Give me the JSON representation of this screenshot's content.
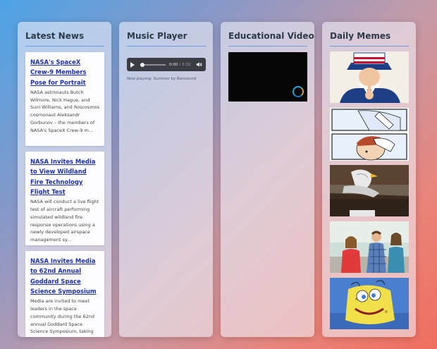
{
  "panels": {
    "news": {
      "title": "Latest News",
      "articles": [
        {
          "title": "NASA's SpaceX Crew-9 Members Pose for Portrait",
          "summary": "NASA astronauts Butch Wilmore, Nick Hague, and Suni Williams, and Roscosmos cosmonaut Aleksandr Gorbunov – the members of NASA's SpaceX Crew-9 m..."
        },
        {
          "title": "NASA Invites Media to View Wildland Fire Technology Flight Test",
          "summary": "NASA will conduct a live flight test of aircraft performing simulated wildland fire response operations using a newly developed airspace management sy..."
        },
        {
          "title": "NASA Invites Media to 62nd Annual Goddard Space Science Symposium",
          "summary": "Media are invited to meet leaders in the space community during the 62nd annual Goddard Space Science Symposium, taking"
        }
      ]
    },
    "music": {
      "title": "Music Player",
      "current_time": "0:00",
      "duration": "/ 3:32",
      "progress": 0,
      "now_playing": "Now playing: Summer by Bensound"
    },
    "videos": {
      "title": "Educational Videos"
    },
    "memes": {
      "title": "Daily Memes",
      "items": [
        {
          "icon": "uncle-sam-meme-image"
        },
        {
          "icon": "sweating-towel-guy-meme-image"
        },
        {
          "icon": "seagull-meme-image"
        },
        {
          "icon": "distracted-boyfriend-meme-image"
        },
        {
          "icon": "mocking-spongebob-meme-image"
        },
        {
          "icon": "meme-image-partial"
        }
      ]
    }
  },
  "colors": {
    "panel_background": "#f0f0f8",
    "title_text": "#2c3a4a",
    "title_rule": "#6b9be0",
    "link": "#1b2fb0",
    "player_background": "#3a3d44"
  }
}
